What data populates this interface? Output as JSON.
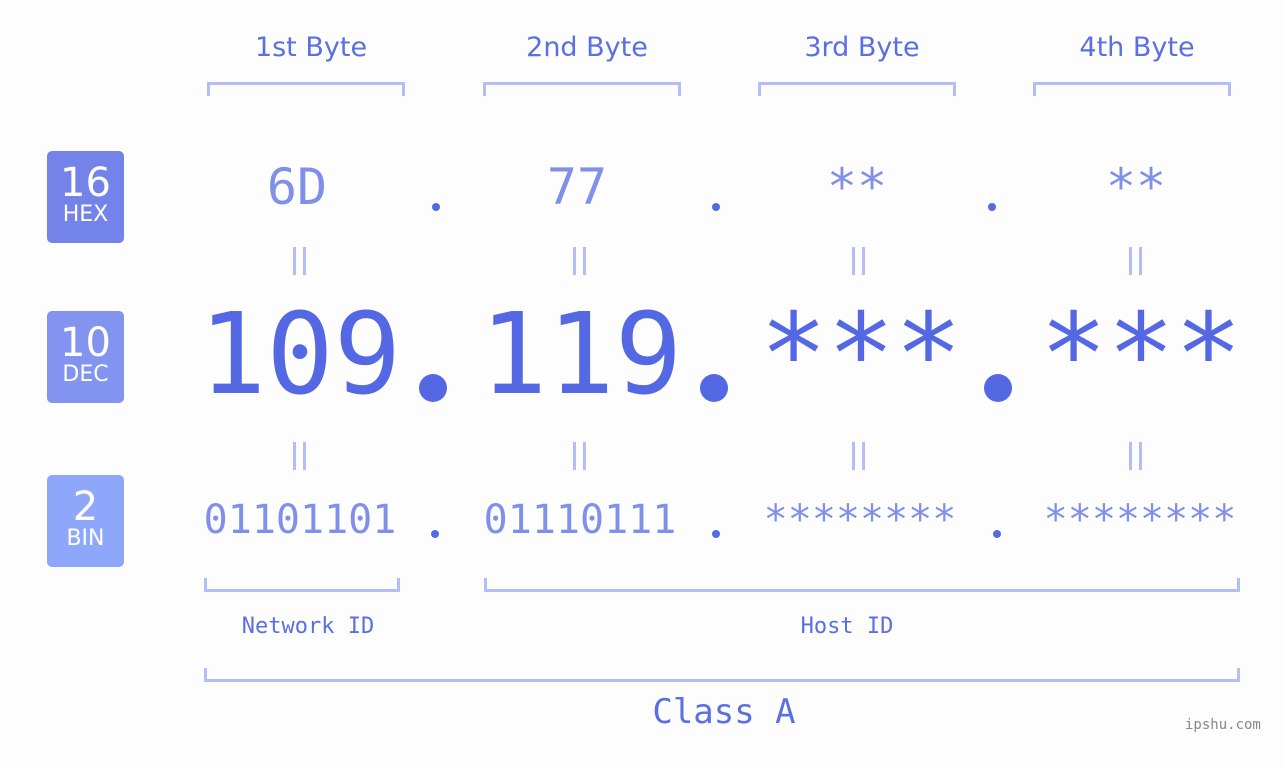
{
  "badges": [
    {
      "num": "16",
      "label": "HEX",
      "color": "#7383e9"
    },
    {
      "num": "10",
      "label": "DEC",
      "color": "#8294ef"
    },
    {
      "num": "2",
      "label": "BIN",
      "color": "#8fa7fa"
    }
  ],
  "headers": [
    "1st Byte",
    "2nd Byte",
    "3rd Byte",
    "4th Byte"
  ],
  "hex": [
    "6D",
    "77",
    "**",
    "**"
  ],
  "dec": [
    "109",
    "119",
    "***",
    "***"
  ],
  "bin": [
    "01101101",
    "01110111",
    "********",
    "********"
  ],
  "ids": {
    "network": "Network ID",
    "host": "Host ID"
  },
  "class_label": "Class A",
  "watermark": "ipshu.com",
  "colors": {
    "accent": "#5468e4",
    "light": "#8090ea",
    "bracket": "#b3bdf6"
  }
}
